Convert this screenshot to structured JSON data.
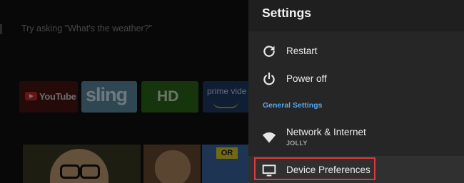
{
  "home": {
    "voice_prompt": "Try asking \"What's the weather?\"",
    "apps": [
      {
        "name": "YouTube",
        "label": "YouTube"
      },
      {
        "name": "Sling",
        "label": "sling"
      },
      {
        "name": "HD",
        "label": "HD"
      },
      {
        "name": "Prime Video",
        "label": "prime vide"
      }
    ],
    "tile_badge": "OR"
  },
  "settings": {
    "title": "Settings",
    "items": [
      {
        "label": "Restart",
        "icon": "restart-icon"
      },
      {
        "label": "Power off",
        "icon": "power-icon"
      }
    ],
    "section": "General Settings",
    "network": {
      "label": "Network & Internet",
      "sub": "JOLLY",
      "icon": "wifi-icon"
    },
    "device": {
      "label": "Device Preferences",
      "icon": "tv-icon"
    }
  },
  "colors": {
    "accent": "#5aa7f0",
    "highlight": "#e0393b",
    "panel": "#262626"
  }
}
